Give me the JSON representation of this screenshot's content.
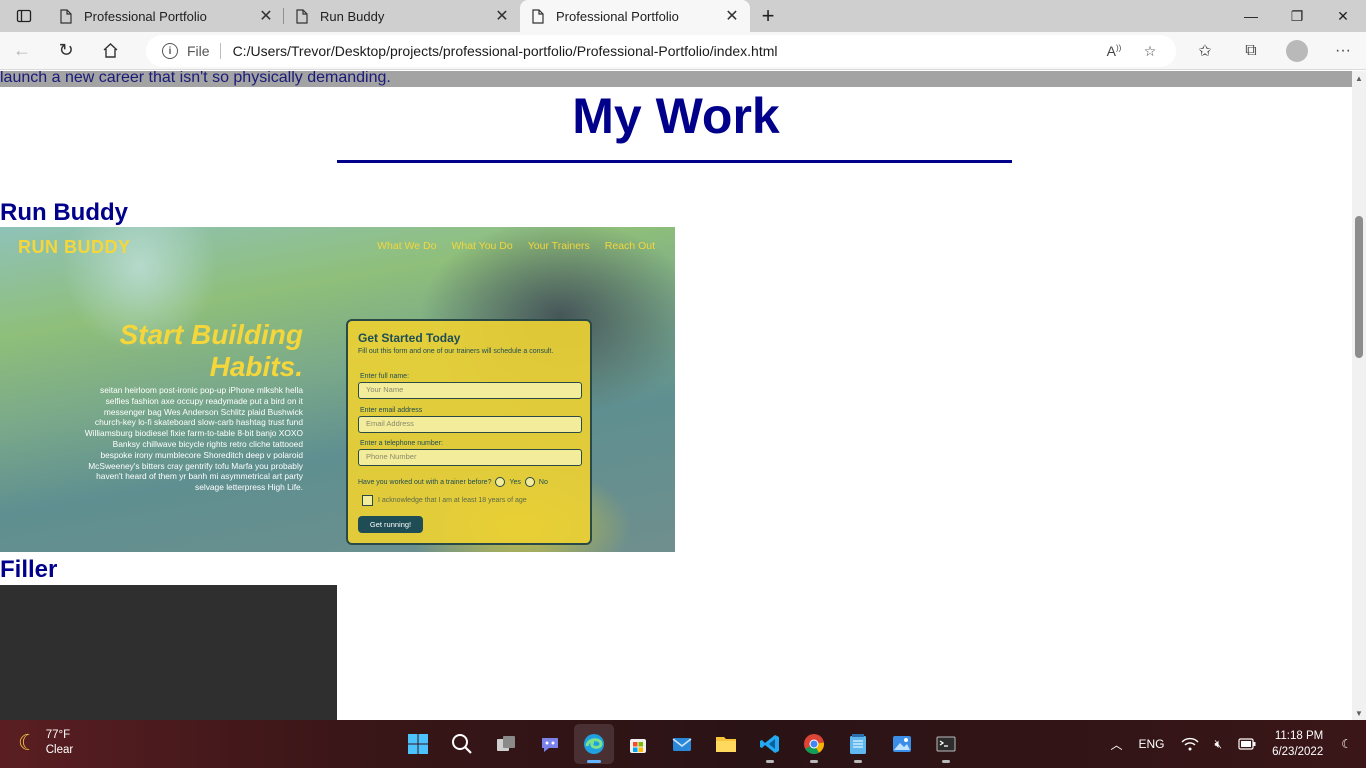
{
  "browser": {
    "tabs": [
      {
        "title": "Professional Portfolio",
        "active": false
      },
      {
        "title": "Run Buddy",
        "active": false
      },
      {
        "title": "Professional Portfolio",
        "active": true
      }
    ],
    "address": {
      "scheme": "File",
      "url": "C:/Users/Trevor/Desktop/projects/professional-portfolio/Professional-Portfolio/index.html"
    }
  },
  "page": {
    "about_tail": "launch a new career that isn't so physically demanding.",
    "section_title": "My Work",
    "projects": [
      {
        "title": "Run Buddy"
      },
      {
        "title": "Filler"
      }
    ],
    "run_buddy_preview": {
      "brand": "RUN BUDDY",
      "nav": [
        "What We Do",
        "What You Do",
        "Your Trainers",
        "Reach Out"
      ],
      "hero_title": "Start Building Habits.",
      "hero_text": "seitan heirloom post-ironic pop-up iPhone mlkshk hella selfies fashion axe occupy readymade put a bird on it messenger bag Wes Anderson Schlitz plaid Bushwick church-key lo-fi skateboard slow-carb hashtag trust fund Williamsburg biodiesel fixie farm-to-table 8-bit banjo XOXO Banksy chillwave bicycle rights retro cliche tattooed bespoke irony mumblecore Shoreditch deep v polaroid McSweeney's bitters cray gentrify tofu Marfa you probably haven't heard of them yr banh mi asymmetrical art party selvage letterpress High Life.",
      "form": {
        "title": "Get Started Today",
        "subtitle": "Fill out this form and one of our trainers will schedule a consult.",
        "name_label": "Enter full name:",
        "name_placeholder": "Your Name",
        "email_label": "Enter email address",
        "email_placeholder": "Email Address",
        "phone_label": "Enter a telephone number:",
        "phone_placeholder": "Phone Number",
        "question": "Have you worked out with a trainer before?",
        "yes": "Yes",
        "no": "No",
        "acknowledge": "I acknowledge that I am at least 18 years of age",
        "button": "Get running!"
      }
    }
  },
  "taskbar": {
    "weather": {
      "temp": "77°F",
      "condition": "Clear"
    },
    "apps": [
      "start",
      "search",
      "task-view",
      "teams-chat",
      "edge",
      "microsoft-store",
      "mail",
      "file-explorer",
      "vs-code",
      "chrome",
      "notepad",
      "photos",
      "terminal"
    ],
    "language": "ENG",
    "time": "11:18 PM",
    "date": "6/23/2022"
  }
}
